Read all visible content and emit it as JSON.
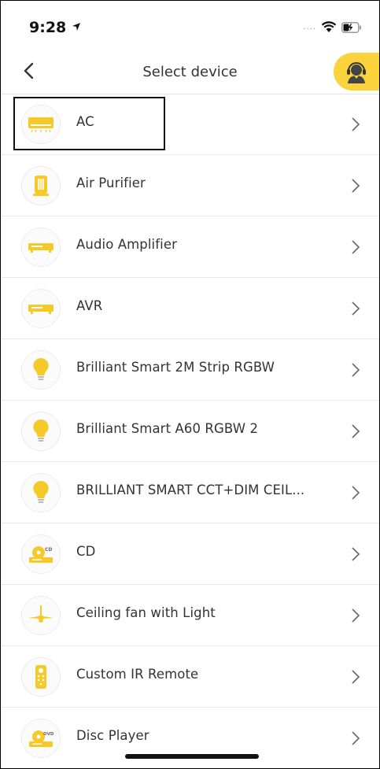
{
  "status_bar": {
    "time": "9:28"
  },
  "nav": {
    "title": "Select device"
  },
  "colors": {
    "accent": "#f9d23c",
    "icon_fill": "#f5c928"
  },
  "devices": [
    {
      "label": "AC",
      "icon": "air-conditioner-icon"
    },
    {
      "label": "Air Purifier",
      "icon": "air-purifier-icon"
    },
    {
      "label": "Audio Amplifier",
      "icon": "amplifier-icon"
    },
    {
      "label": "AVR",
      "icon": "amplifier-icon"
    },
    {
      "label": "Brilliant Smart 2M Strip RGBW",
      "icon": "light-bulb-icon"
    },
    {
      "label": "Brilliant Smart A60 RGBW 2",
      "icon": "light-bulb-icon"
    },
    {
      "label": "BRILLIANT SMART CCT+DIM CEIL...",
      "icon": "light-bulb-icon"
    },
    {
      "label": "CD",
      "icon": "cd-player-icon"
    },
    {
      "label": "Ceiling fan with Light",
      "icon": "ceiling-fan-icon"
    },
    {
      "label": "Custom IR Remote",
      "icon": "remote-control-icon"
    },
    {
      "label": "Disc Player",
      "icon": "dvd-player-icon"
    }
  ]
}
